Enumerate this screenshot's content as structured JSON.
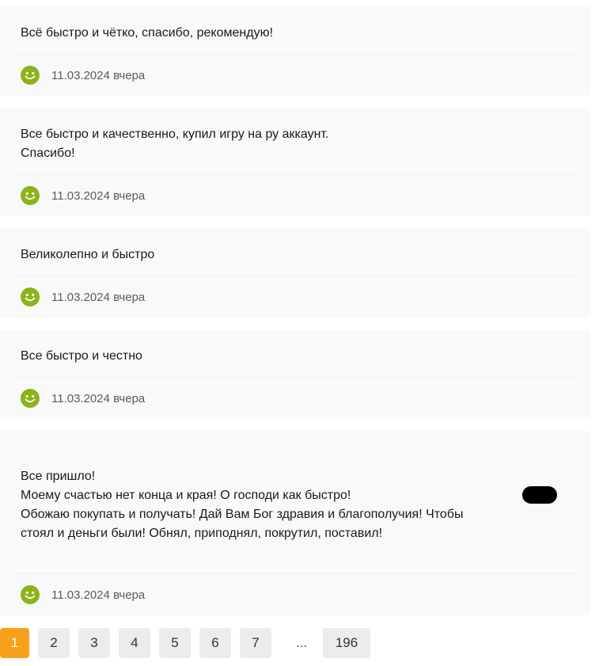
{
  "reviews": [
    {
      "text": "Всё быстро и чётко, спасибо, рекомендую!",
      "date": "11.03.2024 вчера"
    },
    {
      "text": "Все быстро и качественно, купил игру на ру аккаунт.\nСпасибо!",
      "date": "11.03.2024 вчера"
    },
    {
      "text": "Великолепно и быстро",
      "date": "11.03.2024 вчера"
    },
    {
      "text": "Все быстро и честно",
      "date": "11.03.2024 вчера"
    },
    {
      "text": "Все пришло!\nМоему счастью нет конца и края! О господи как быстро!\nОбожаю покупать и получать! Дай Вам Бог здравия и благополучия! Чтобы\nстоял и деньги были! Обнял, приподнял, покрутил, поставил!",
      "date": "11.03.2024 вчера"
    }
  ],
  "pagination": {
    "pages": [
      "1",
      "2",
      "3",
      "4",
      "5",
      "6",
      "7"
    ],
    "ellipsis": "...",
    "last": "196",
    "active": "1"
  },
  "colors": {
    "accent": "#f7a11a",
    "smile": "#8db31a",
    "card_bg": "#f9f9f9"
  },
  "icons": {
    "review_rating": "smile-icon"
  }
}
